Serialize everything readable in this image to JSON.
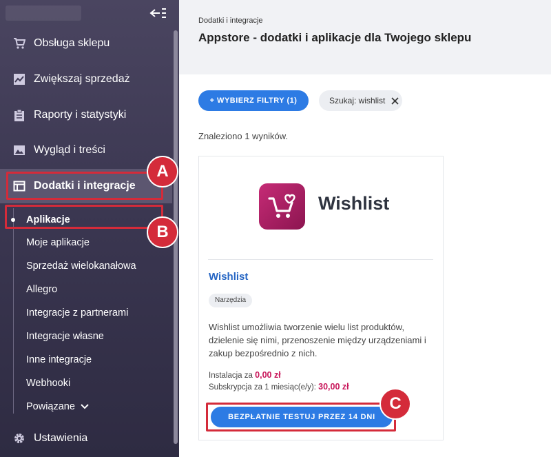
{
  "sidebar": {
    "menu": [
      {
        "label": "Obsługa sklepu",
        "icon": "cart-icon"
      },
      {
        "label": "Zwiększaj sprzedaż",
        "icon": "trend-chart-icon"
      },
      {
        "label": "Raporty i statystyki",
        "icon": "clipboard-icon"
      },
      {
        "label": "Wygląd i treści",
        "icon": "image-icon"
      },
      {
        "label": "Dodatki i integracje",
        "icon": "window-icon",
        "active": true
      }
    ],
    "submenu": [
      {
        "label": "Aplikacje",
        "active": true
      },
      {
        "label": "Moje aplikacje"
      },
      {
        "label": "Sprzedaż wielokanałowa"
      },
      {
        "label": "Allegro"
      },
      {
        "label": "Integracje z partnerami"
      },
      {
        "label": "Integracje własne"
      },
      {
        "label": "Inne integracje"
      },
      {
        "label": "Webhooki"
      },
      {
        "label": "Powiązane"
      }
    ],
    "settings_label": "Ustawienia"
  },
  "callouts": {
    "a": "A",
    "b": "B",
    "c": "C"
  },
  "header": {
    "breadcrumb": "Dodatki i integracje",
    "title": "Appstore - dodatki i aplikacje dla Twojego sklepu"
  },
  "filters": {
    "button_label": "+ WYBIERZ FILTRY (1)",
    "search_chip": "Szukaj: wishlist"
  },
  "results_text": "Znaleziono 1 wyników.",
  "app": {
    "wordmark": "Wishlist",
    "name": "Wishlist",
    "tag": "Narzędzia",
    "description": "Wishlist umożliwia tworzenie wielu list produktów, dzielenie się nimi, przenoszenie między urządzeniami i zakup bezpośrednio z nich.",
    "install_label": "Instalacja za",
    "install_price": "0,00 zł",
    "subscription_label": "Subskrypcja za 1 miesiąc(e/y):",
    "subscription_price": "30,00 zł",
    "trial_button": "BEZPŁATNIE TESTUJ PRZEZ 14 DNI"
  },
  "colors": {
    "accent": "#2d7be4",
    "callout": "#d42b3a",
    "price": "#c8165a",
    "sidebar": "#3a3650"
  }
}
